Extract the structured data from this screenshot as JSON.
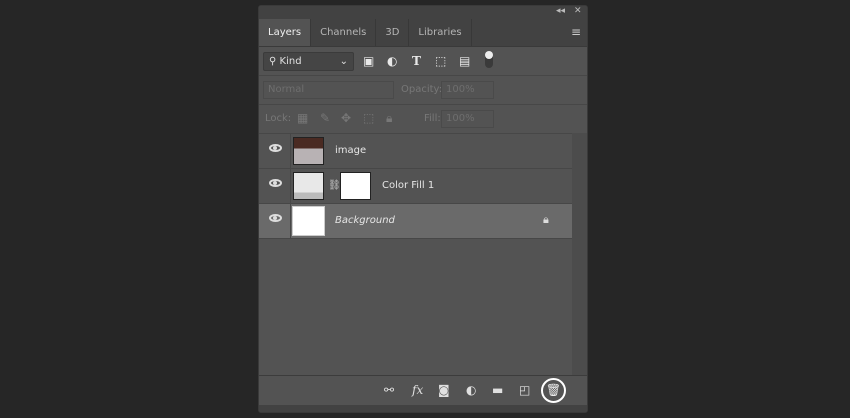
{
  "panel": {
    "collapse_icon": "double-chevron-left",
    "close_icon": "close"
  },
  "tabs": [
    {
      "label": "Layers",
      "active": true
    },
    {
      "label": "Channels"
    },
    {
      "label": "3D"
    },
    {
      "label": "Libraries"
    }
  ],
  "filter": {
    "kind": "Kind",
    "icons": [
      "image-filter",
      "adjustment-filter",
      "type-filter",
      "shape-filter",
      "smart-object-filter",
      "filter-toggle"
    ]
  },
  "blend": {
    "mode": "Normal",
    "opacity_label": "Opacity:",
    "opacity": "100%"
  },
  "lock": {
    "label": "Lock:",
    "fill_label": "Fill:",
    "fill": "100%"
  },
  "layers": [
    {
      "name": "image",
      "visible": true,
      "italic": false
    },
    {
      "name": "Color Fill 1",
      "visible": true
    },
    {
      "name": "Background",
      "visible": true,
      "italic": true,
      "locked": true,
      "selected": true
    }
  ],
  "footer_icons": [
    "link",
    "fx",
    "mask",
    "adjustment",
    "group",
    "new-layer",
    "delete"
  ]
}
